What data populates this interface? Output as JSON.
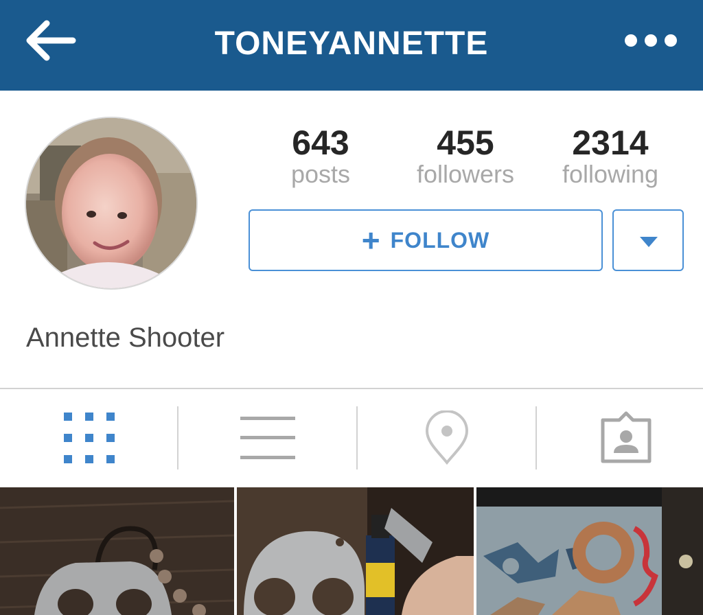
{
  "header": {
    "title": "TONEYANNETTE",
    "back_icon": "arrow-left-icon",
    "more_icon": "more-dots-icon"
  },
  "profile": {
    "avatar": "avatar",
    "full_name": "Annette Shooter",
    "stats": [
      {
        "value": "643",
        "label": "posts"
      },
      {
        "value": "455",
        "label": "followers"
      },
      {
        "value": "2314",
        "label": "following"
      }
    ],
    "follow_button": {
      "plus": "+",
      "label": "FOLLOW"
    },
    "dropdown_icon": "caret-down-icon"
  },
  "tabs": [
    {
      "name": "grid-view",
      "icon": "grid-icon",
      "active": true
    },
    {
      "name": "list-view",
      "icon": "list-icon",
      "active": false
    },
    {
      "name": "photo-map",
      "icon": "location-pin-icon",
      "active": false
    },
    {
      "name": "tagged-photos",
      "icon": "tagged-person-icon",
      "active": false
    }
  ],
  "colors": {
    "header_bg": "#1a5a8e",
    "accent": "#3f85cb",
    "inactive_icon": "#a8a8a8"
  }
}
